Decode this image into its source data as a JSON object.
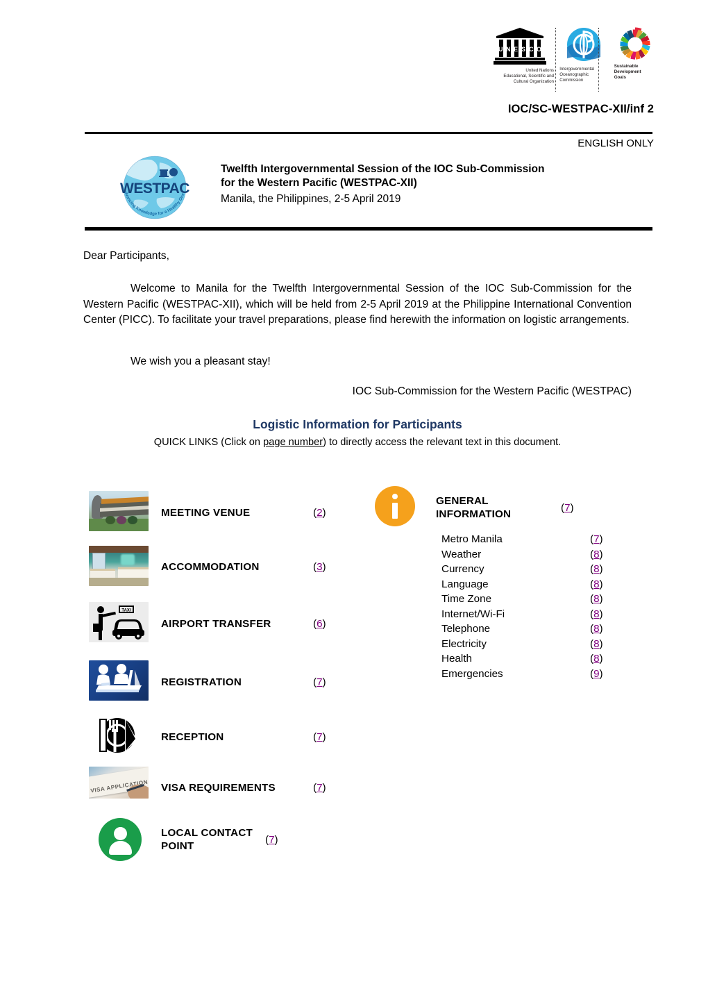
{
  "header": {
    "logos": [
      {
        "name": "unesco-logo",
        "caption": "United Nations\nEducational, Scientific and\nCultural Organization"
      },
      {
        "name": "ioc-logo",
        "caption": "Intergovernmental\nOceanographic\nCommission"
      },
      {
        "name": "sdg-logo",
        "caption": "Sustainable\nDevelopment\nGoals"
      }
    ],
    "doc_code": "IOC/SC-WESTPAC-XII/inf 2",
    "language_note": "ENGLISH ONLY"
  },
  "meeting": {
    "logo_alt": "WESTPAC",
    "title_line1": "Twelfth Intergovernmental Session of the IOC Sub-Commission",
    "title_line2": "for the Western Pacific (WESTPAC-XII)",
    "subtitle": "Manila, the Philippines, 2-5 April 2019"
  },
  "letter": {
    "salutation": "Dear Participants,",
    "paragraph1": "Welcome to Manila for the Twelfth Intergovernmental Session of the IOC Sub-Commission for the Western Pacific (WESTPAC-XII), which will be held from 2-5 April 2019 at the Philippine International Convention Center (PICC). To facilitate your travel preparations, please find herewith the information on logistic arrangements.",
    "paragraph2": "We wish you a pleasant stay!",
    "signature": "IOC Sub-Commission for the Western Pacific (WESTPAC)"
  },
  "section": {
    "title": "Logistic Information for Participants",
    "title_color": "#1f3864",
    "quick_links_prefix": "QUICK LINKS (Click on ",
    "quick_links_link": "page number",
    "quick_links_suffix": ") to directly access the relevant text in this document."
  },
  "quick_links": {
    "link_color": "#800080",
    "left_column": [
      {
        "icon": "convention-center-icon",
        "label": "MEETING VENUE",
        "page": "2"
      },
      {
        "icon": "hotel-room-icon",
        "label": "ACCOMMODATION",
        "page": "3"
      },
      {
        "icon": "taxi-icon",
        "label": "AIRPORT TRANSFER",
        "page": "6"
      },
      {
        "icon": "registration-desk-icon",
        "label": "REGISTRATION",
        "page": "7"
      },
      {
        "icon": "dining-plate-icon",
        "label": "RECEPTION",
        "page": "7"
      },
      {
        "icon": "visa-application-icon",
        "label": "VISA REQUIREMENTS",
        "page": "7"
      },
      {
        "icon": "person-circle-icon",
        "label": "LOCAL CONTACT POINT",
        "page": "7"
      }
    ],
    "right_column": {
      "icon": "info-circle-icon",
      "label": "GENERAL INFORMATION",
      "page": "7",
      "items": [
        {
          "label": "Metro Manila",
          "page": "7"
        },
        {
          "label": "Weather",
          "page": "8"
        },
        {
          "label": "Currency",
          "page": "8"
        },
        {
          "label": "Language",
          "page": "8"
        },
        {
          "label": "Time Zone",
          "page": "8"
        },
        {
          "label": "Internet/Wi-Fi",
          "page": "8"
        },
        {
          "label": "Telephone",
          "page": "8"
        },
        {
          "label": "Electricity",
          "page": "8"
        },
        {
          "label": "Health",
          "page": "8"
        },
        {
          "label": "Emergencies",
          "page": "9"
        }
      ]
    }
  }
}
